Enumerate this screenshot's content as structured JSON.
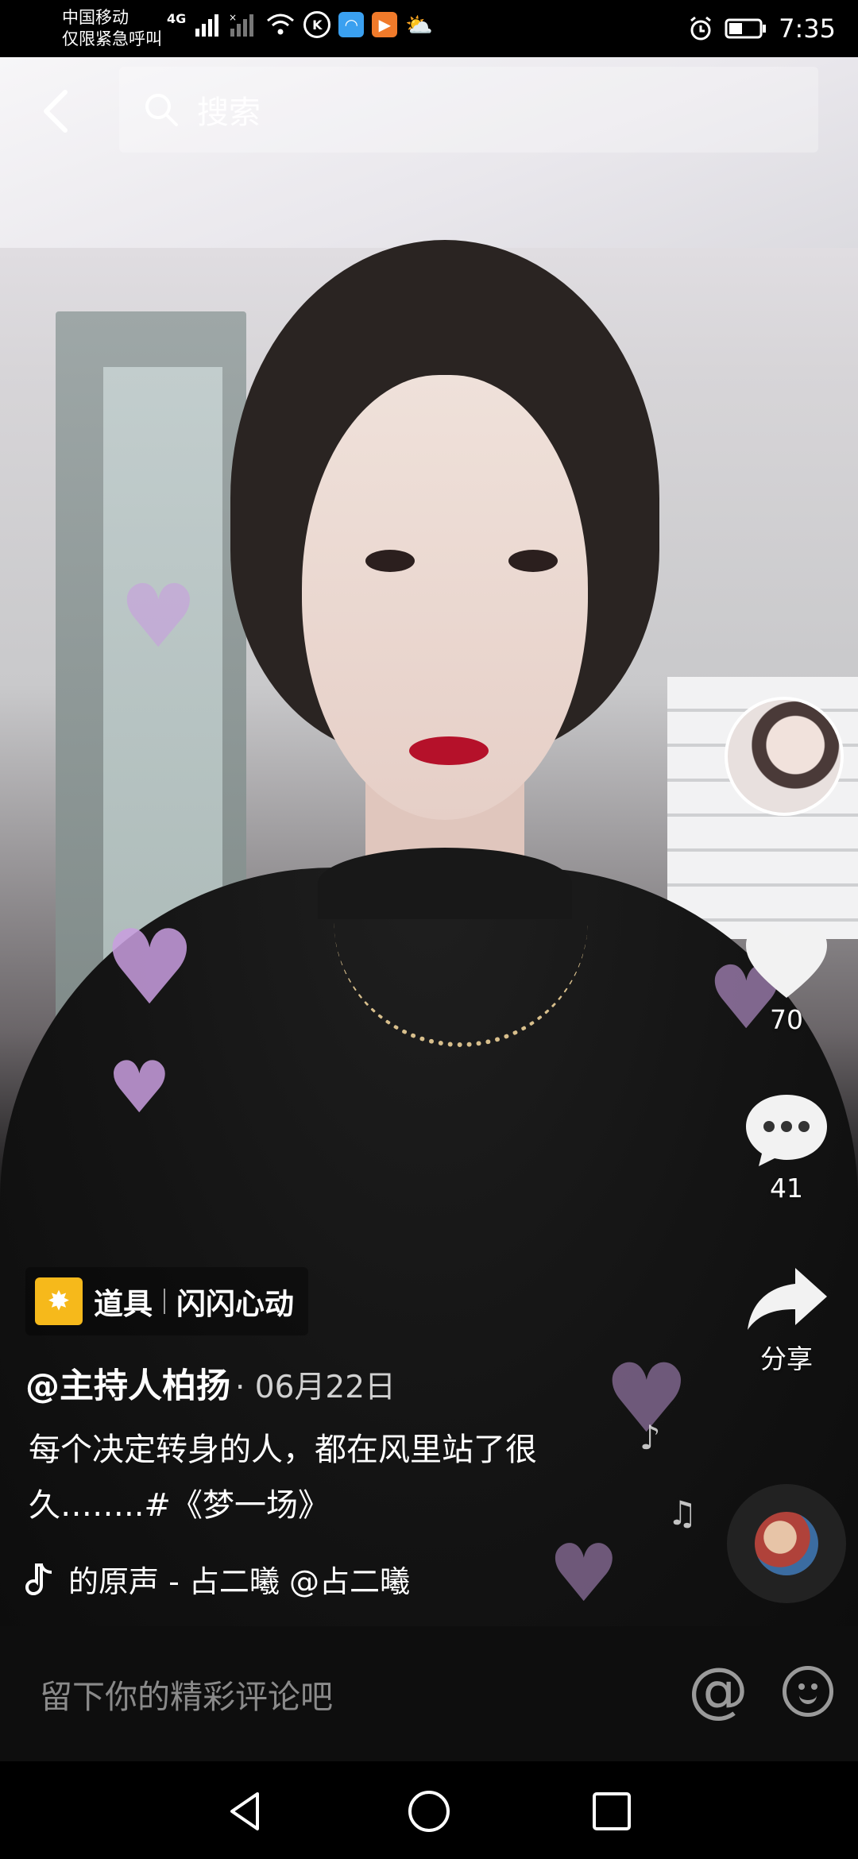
{
  "status_bar": {
    "carrier": "中国移动",
    "carrier_sub": "仅限紧急呼叫",
    "network": "4G",
    "time": "7:35"
  },
  "search": {
    "placeholder": "搜索"
  },
  "video": {
    "likes": "70",
    "comments": "41",
    "share_label": "分享",
    "prop_label": "道具",
    "prop_name": "闪闪心动",
    "author": "@主持人柏扬",
    "date": "· 06月22日",
    "caption": "每个决定转身的人，都在风里站了很久……..#《梦一场》",
    "music": "的原声 - 占二曦   @占二曦"
  },
  "comment_bar": {
    "placeholder": "留下你的精彩评论吧",
    "at_symbol": "@"
  },
  "icons": [
    "back-icon",
    "search-icon",
    "heart-icon",
    "comment-icon",
    "share-icon",
    "music-note-icon",
    "at-icon",
    "emoji-icon",
    "nav-back-icon",
    "nav-home-icon",
    "nav-recents-icon"
  ]
}
